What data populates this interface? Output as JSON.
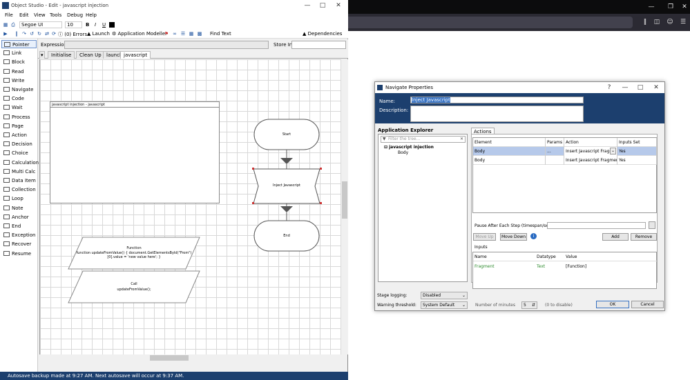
{
  "studio": {
    "title": "Object Studio - Edit - javascript injection",
    "menu": [
      "File",
      "Edit",
      "View",
      "Tools",
      "Debug",
      "Help"
    ],
    "toolbar": {
      "font": "Segoe UI",
      "font_size": "10",
      "bold": "B",
      "italic": "I",
      "underline": "U",
      "errors": "(0) Errors",
      "launch": "Launch",
      "app_modeller": "Application Modeller",
      "find_text": "Find Text",
      "dependencies": "Dependencies"
    },
    "expression_label": "Expression:",
    "store_label": "Store In:",
    "palette": [
      "Pointer",
      "Link",
      "Block",
      "Read",
      "Write",
      "Navigate",
      "Code",
      "Wait",
      "Process",
      "Page",
      "Action",
      "Decision",
      "Choice",
      "Calculation",
      "Multi Calc",
      "Data Item",
      "Collection",
      "Loop",
      "Note",
      "Anchor",
      "End",
      "Exception",
      "Recover",
      "Resume"
    ],
    "tabs": [
      "Initialise",
      "Clean Up",
      "launch",
      "javascript"
    ],
    "canvas": {
      "page_box_title": "javascript injection - javascript",
      "start": "Start",
      "inject": "Inject Javascript",
      "end": "End",
      "function_label": "Function",
      "function_code": "function updateFromValue() { document.GetElementsById(\"From\")[0].value = 'new value here'; }",
      "call_label": "Call",
      "call_code": "updateFromValue();"
    },
    "status": "Autosave backup made at 9:27 AM. Next autosave will occur at 9:37 AM."
  },
  "dialog": {
    "title": "Navigate Properties",
    "help": "?",
    "name_label": "Name:",
    "name_value": "Inject Javascript",
    "description_label": "Description:",
    "explorer_label": "Application Explorer",
    "filter_placeholder": "Filter the tree...",
    "tree_root": "javascript injection",
    "tree_child": "Body",
    "actions_tab": "Actions",
    "columns": [
      "Element",
      "Params",
      "Action",
      "Inputs Set"
    ],
    "rows": [
      {
        "element": "Body",
        "params": "...",
        "action": "Insert Javascript Fragm",
        "inputs_set": "Yes"
      },
      {
        "element": "Body",
        "params": "",
        "action": "Insert Javascript Fragment",
        "inputs_set": "Yes"
      }
    ],
    "pause_label": "Pause After Each Step (timespan/secs)",
    "move_up": "Move Up",
    "move_down": "Move Down",
    "add": "Add",
    "remove": "Remove",
    "inputs_label": "Inputs",
    "input_columns": [
      "Name",
      "Datatype",
      "Value"
    ],
    "input_rows": [
      {
        "name": "Fragment",
        "datatype": "Text",
        "value": "[Function]"
      }
    ],
    "stage_logging_label": "Stage logging:",
    "stage_logging_value": "Disabled",
    "warning_label": "Warning threshold:",
    "warning_value": "System Default",
    "minutes_label": "Number of minutes",
    "minutes_value": "5",
    "disable_hint": "(0 to disable)",
    "ok": "OK",
    "cancel": "Cancel"
  },
  "colors": {
    "header_blue": "#1c3f6e",
    "selection": "#b6c9ea",
    "green_text": "#2e8b2e"
  }
}
